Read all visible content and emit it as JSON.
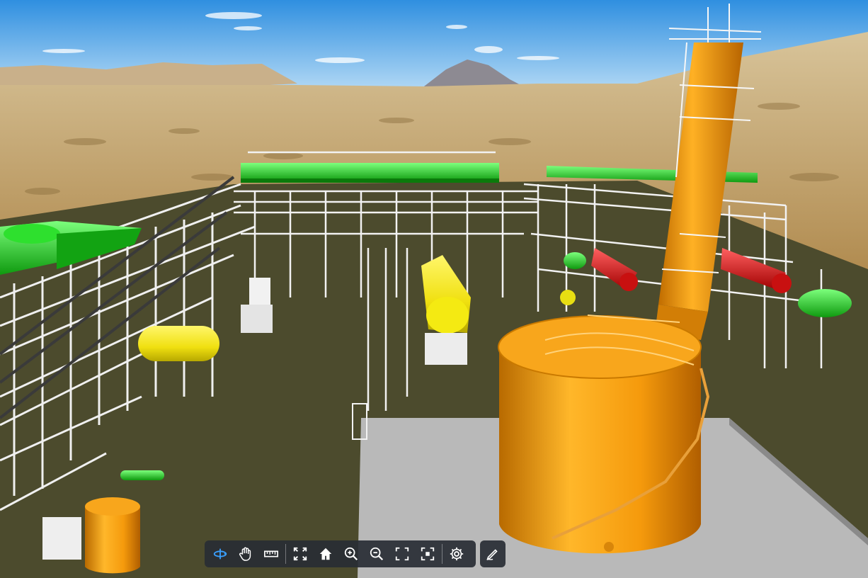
{
  "scene": {
    "name": "process-plant-3d-model",
    "colors": {
      "sky_top": "#3f97e0",
      "sky_bottom": "#b9dcf5",
      "desert": "#c9a86c",
      "ground": "#4b4a2c",
      "pad": "#bdbdbd",
      "tank_orange": "#f2a011",
      "vessel_yellow": "#f4ea12",
      "cooler_green": "#22d022",
      "exchanger_red": "#e01818",
      "pipe_white": "#f2f2f2"
    }
  },
  "toolbar": {
    "buttons": [
      {
        "name": "orbit-button",
        "icon": "orbit-icon",
        "active": true
      },
      {
        "name": "pan-button",
        "icon": "hand-icon"
      },
      {
        "name": "measure-button",
        "icon": "ruler-icon"
      },
      {
        "name": "fit-view-button",
        "icon": "fit-view-icon"
      },
      {
        "name": "home-button",
        "icon": "home-icon"
      },
      {
        "name": "zoom-in-button",
        "icon": "zoom-in-icon"
      },
      {
        "name": "zoom-out-button",
        "icon": "zoom-out-icon"
      },
      {
        "name": "zoom-window-button",
        "icon": "zoom-window-icon"
      },
      {
        "name": "focus-selection-button",
        "icon": "focus-icon"
      },
      {
        "name": "settings-button",
        "icon": "gear-icon"
      },
      {
        "name": "markup-button",
        "icon": "pen-icon"
      }
    ],
    "accent": "#3aa0ff",
    "icon_color": "#ffffff"
  }
}
